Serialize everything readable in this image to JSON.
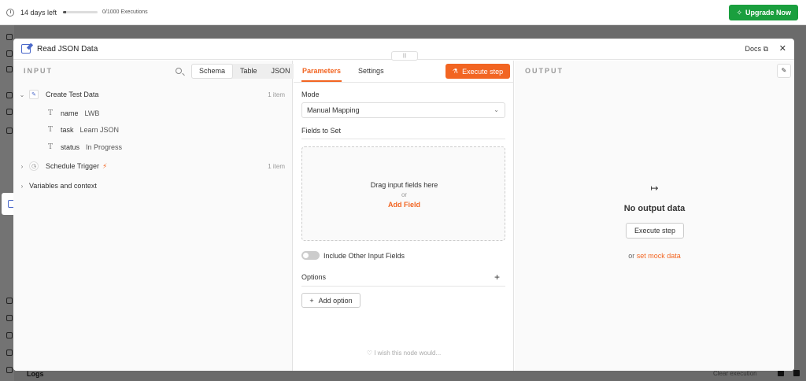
{
  "trial": {
    "days_left": "14 days left",
    "executions": "0/1000 Executions",
    "usage_fraction": 0.05,
    "upgrade_label": "Upgrade Now"
  },
  "background": {
    "logs_label": "Logs",
    "clear_label": "Clear execution"
  },
  "modal": {
    "title": "Read JSON Data",
    "docs_label": "Docs",
    "close_glyph": "✕",
    "drag_glyph": "|||"
  },
  "input": {
    "label": "INPUT",
    "tabs": [
      "Schema",
      "Table",
      "JSON"
    ],
    "active_tab": "Schema",
    "nodes": [
      {
        "name": "Create Test Data",
        "count": "1 item",
        "expanded": true,
        "fields": [
          {
            "name": "name",
            "value": "LWB"
          },
          {
            "name": "task",
            "value": "Learn JSON"
          },
          {
            "name": "status",
            "value": "In Progress"
          }
        ]
      },
      {
        "name": "Schedule Trigger",
        "count": "1 item",
        "expanded": false
      }
    ],
    "variables_label": "Variables and context"
  },
  "parameters": {
    "tabs": [
      "Parameters",
      "Settings"
    ],
    "active_tab": "Parameters",
    "execute_label": "Execute step",
    "mode_label": "Mode",
    "mode_value": "Manual Mapping",
    "fields_label": "Fields to Set",
    "drop_text": "Drag input fields here",
    "drop_or": "or",
    "add_field": "Add Field",
    "include_label": "Include Other Input Fields",
    "include_on": false,
    "options_label": "Options",
    "add_option_label": "Add option",
    "wish_text": "I wish this node would..."
  },
  "output": {
    "label": "OUTPUT",
    "no_data": "No output data",
    "execute_label": "Execute step",
    "mock_prefix": "or",
    "mock_link": "set mock data"
  },
  "colors": {
    "accent": "#f26522",
    "upgrade": "#1a9f3e",
    "node_blue": "#4a68c9"
  }
}
